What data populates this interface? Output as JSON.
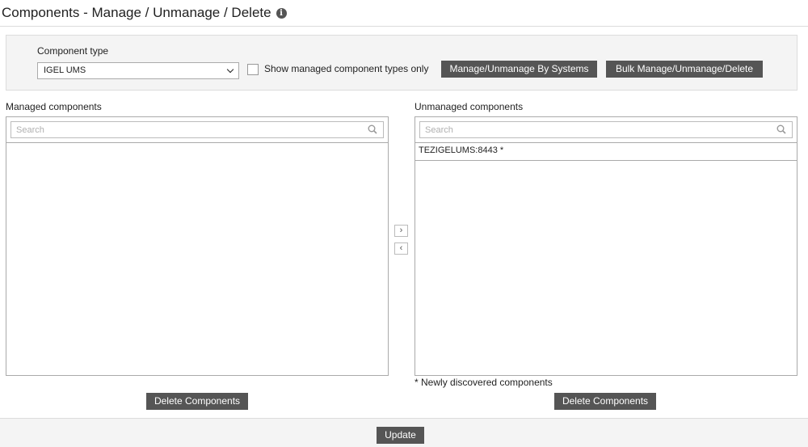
{
  "header": {
    "title": "Components - Manage / Unmanage / Delete",
    "info_icon": "info-icon"
  },
  "filters": {
    "component_type_label": "Component type",
    "component_type_selected": "IGEL UMS",
    "show_managed_label": "Show managed component types only",
    "show_managed_checked": false,
    "manage_by_systems_label": "Manage/Unmanage By Systems",
    "bulk_label": "Bulk Manage/Unmanage/Delete"
  },
  "managed": {
    "label": "Managed components",
    "search_placeholder": "Search",
    "items": []
  },
  "unmanaged": {
    "label": "Unmanaged components",
    "search_placeholder": "Search",
    "items": [
      {
        "name": "TEZIGELUMS:8443",
        "marker": "*"
      }
    ]
  },
  "transfer": {
    "to_unmanaged_icon": "chevron-right-icon",
    "to_managed_icon": "chevron-left-icon"
  },
  "legend": {
    "marker": "*",
    "text": "Newly discovered components"
  },
  "actions": {
    "delete_left_label": "Delete Components",
    "delete_right_label": "Delete Components",
    "update_label": "Update"
  },
  "colors": {
    "button_bg": "#555555",
    "panel_bg": "#f4f4f4",
    "border": "#aaaaaa"
  }
}
